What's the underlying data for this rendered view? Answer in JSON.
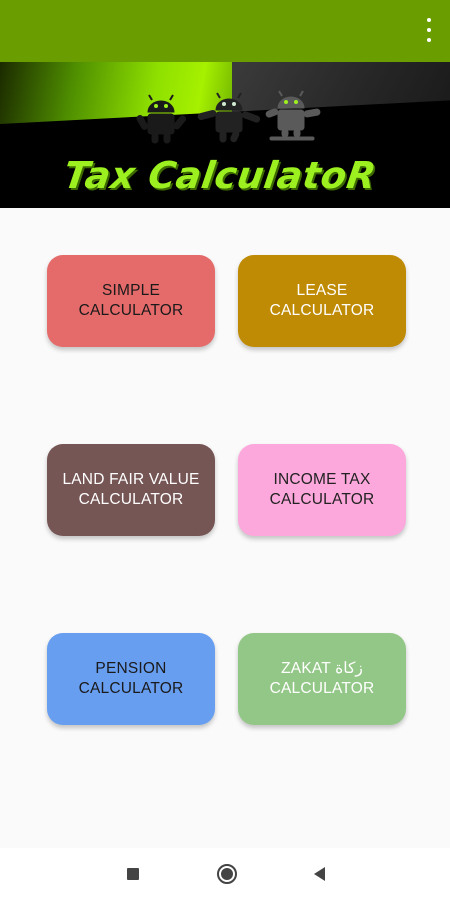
{
  "header": {
    "overflow_icon": "more-vert-icon",
    "colors": {
      "appbar": "#6a9d00"
    }
  },
  "banner": {
    "title": "Tax CalculatoR",
    "robot_icon": "android-robot-icon"
  },
  "calculators": [
    {
      "label": "SIMPLE CALCULATOR",
      "color": "#e56a6a"
    },
    {
      "label": "LEASE CALCULATOR",
      "color": "#bf8a04"
    },
    {
      "label": "LAND FAIR VALUE\nCALCULATOR",
      "color": "#765555"
    },
    {
      "label": "INCOME TAX\nCALCULATOR",
      "color": "#fca8dc"
    },
    {
      "label": "PENSION\nCALCULATOR",
      "color": "#689ef0"
    },
    {
      "label": "ZAKAT زكاة\nCALCULATOR",
      "color": "#93c787"
    }
  ],
  "navbar": {
    "recent_icon": "recent-apps-icon",
    "home_icon": "home-icon",
    "back_icon": "back-icon"
  }
}
